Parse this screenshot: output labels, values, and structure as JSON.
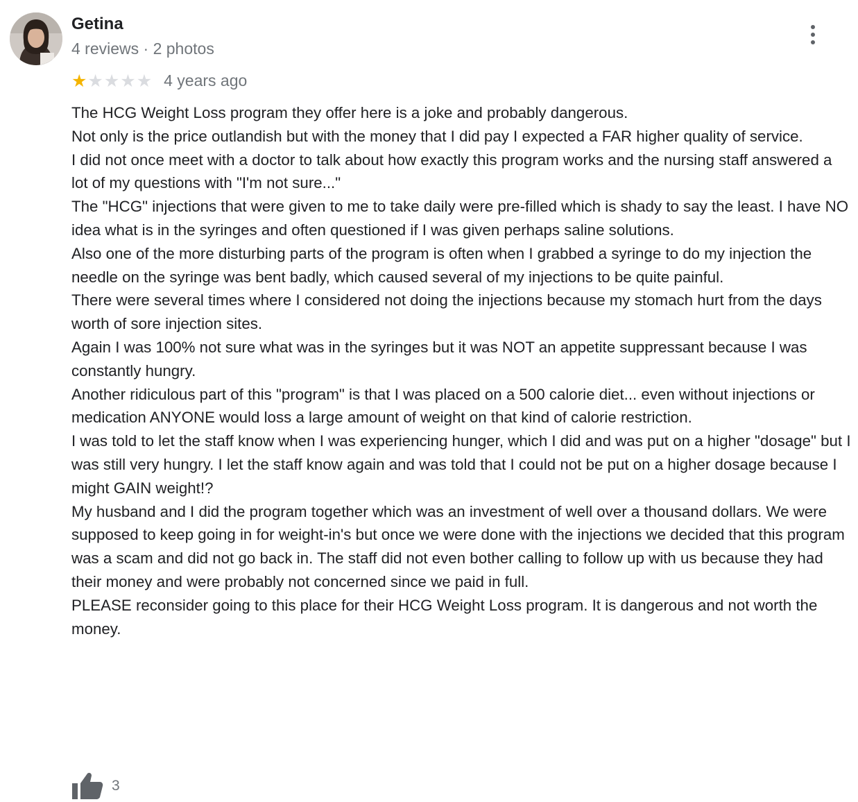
{
  "review": {
    "author": {
      "name": "Getina",
      "meta": "4 reviews · 2 photos",
      "avatar_icon": "user-avatar-photo"
    },
    "rating": {
      "value": 1,
      "max": 5,
      "star_color": "#f4b400",
      "empty_star_color": "#dadce0"
    },
    "date": "4 years ago",
    "more_icon": "more-vert-icon",
    "paragraphs": [
      "The HCG Weight Loss program they offer here is a joke and probably dangerous.",
      "Not only is the price outlandish but with the money that I did pay I expected a FAR higher quality of service.",
      "I did not once meet with a doctor to talk about how exactly this program works and the nursing staff answered a lot of my questions with \"I'm not sure...\"",
      "The \"HCG\" injections that were given to me to take daily were pre-filled which is shady to say the least. I have NO idea what is in the syringes and often questioned if I was given perhaps saline solutions.",
      "Also one of the more disturbing parts of the program is often when I grabbed a syringe to do my injection the needle on the syringe was bent badly, which caused several of my injections to be quite painful.",
      "There were several times where I considered not doing the injections because my stomach hurt from the days worth of sore injection sites.",
      "Again I was 100% not sure what was in the syringes but it was NOT an appetite suppressant because I was constantly hungry.",
      "Another ridiculous part of this \"program\" is that I was placed on a 500 calorie diet... even without injections or medication ANYONE would loss a large amount of weight on that kind of calorie restriction.",
      "I was told to let the staff know when I was experiencing hunger, which I did and was put on a higher \"dosage\" but I was still very hungry. I let the staff know again and was told that I could not be put on a higher dosage because I might GAIN weight!?",
      "My husband and I did the program together which was an investment of well over a thousand dollars. We were supposed to keep going in for weight-in's but once we were done with the injections we decided that this program was a scam and did not go back in. The staff did not even bother calling to follow up with us because they had their money and were probably not concerned since we paid in full.",
      "PLEASE reconsider going to this place for their HCG Weight Loss program. It is dangerous and not worth the money."
    ],
    "likes": {
      "count": "3",
      "icon": "thumbs-up-icon"
    }
  }
}
